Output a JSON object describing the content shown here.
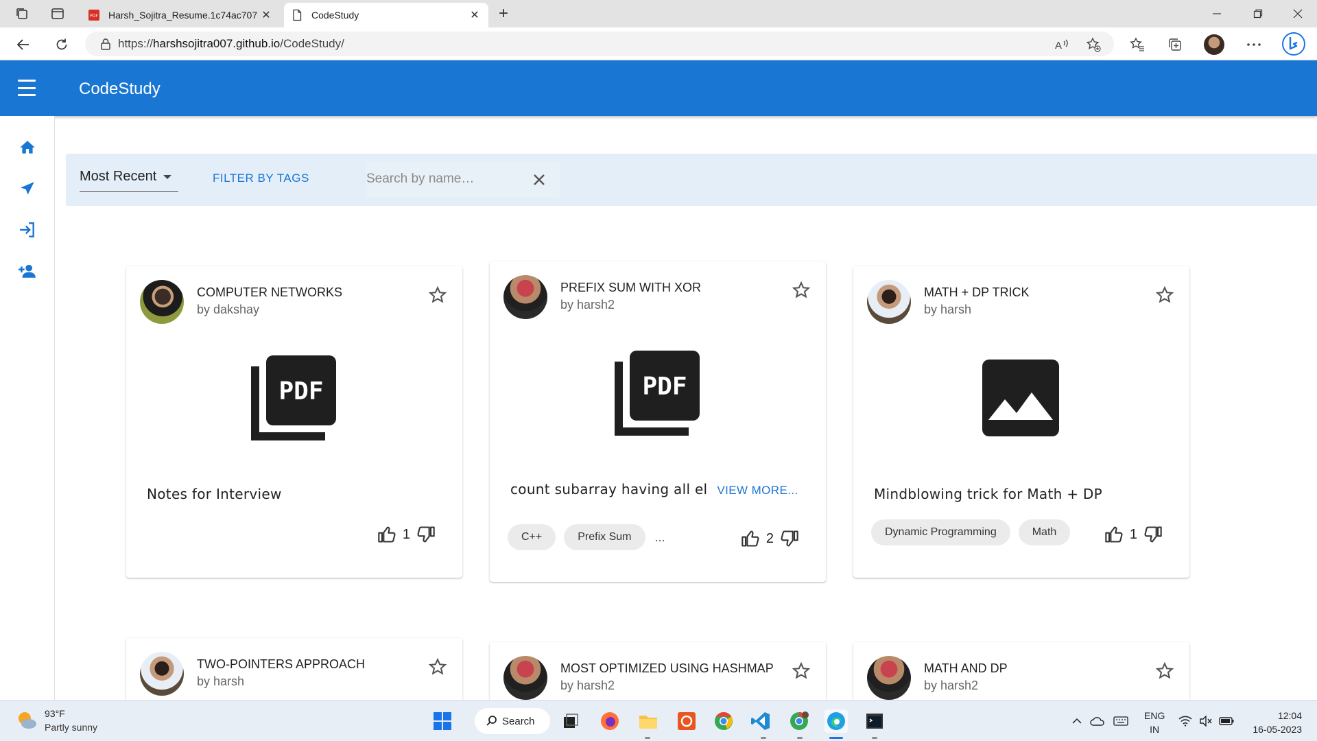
{
  "browser": {
    "tabs": [
      {
        "title": "Harsh_Sojitra_Resume.1c74ac707",
        "active": false
      },
      {
        "title": "CodeStudy",
        "active": true
      }
    ],
    "url_prefix": "https://",
    "url_host": "harshsojitra007.github.io",
    "url_path": "/CodeStudy/"
  },
  "app": {
    "brand": "CodeStudy",
    "accent": "#1976d2",
    "rail_icons": [
      "home-icon",
      "send-icon",
      "login-icon",
      "add-user-icon"
    ]
  },
  "toolbar": {
    "sort_value": "Most Recent",
    "filter_label": "FILTER BY TAGS",
    "search_placeholder": "Search by name…"
  },
  "cards": [
    {
      "title": "COMPUTER NETWORKS",
      "author": "by dakshay",
      "media": "pdf-icon",
      "desc": "Notes for Interview",
      "view_more": "",
      "tags": [],
      "likes": "1"
    },
    {
      "title": "PREFIX SUM WITH XOR",
      "author": "by harsh2",
      "media": "pdf-icon",
      "desc": "count subarray having all el",
      "view_more": "VIEW MORE...",
      "tags": [
        "C++",
        "Prefix Sum"
      ],
      "more_tags": "...",
      "likes": "2"
    },
    {
      "title": "MATH + DP TRICK",
      "author": "by harsh",
      "media": "image-icon",
      "desc": "Mindblowing trick for Math + DP",
      "view_more": "",
      "tags": [
        "Dynamic Programming",
        "Math"
      ],
      "likes": "1"
    },
    {
      "title": "TWO-POINTERS APPROACH",
      "author": "by harsh"
    },
    {
      "title": "MOST OPTIMIZED USING HASHMAP",
      "author": "by harsh2"
    },
    {
      "title": "MATH AND DP",
      "author": "by harsh2"
    }
  ],
  "taskbar": {
    "weather_temp": "93°F",
    "weather_desc": "Partly sunny",
    "search_label": "Search",
    "lang_line1": "ENG",
    "lang_line2": "IN",
    "time": "12:04",
    "date": "16-05-2023"
  }
}
